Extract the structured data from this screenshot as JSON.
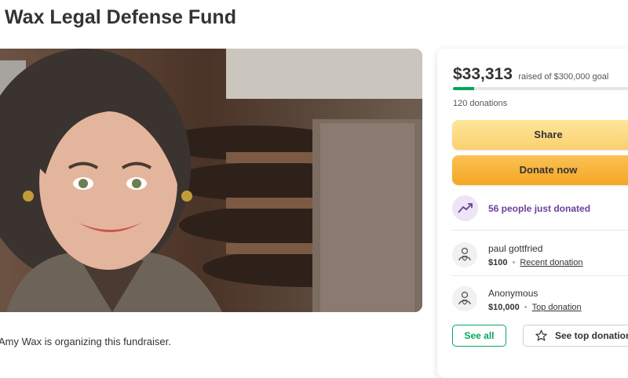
{
  "page": {
    "title": "Wax Legal Defense Fund",
    "organizer_text": "Amy Wax is organizing this fundraiser."
  },
  "hero": {
    "image_alt": "Photo of Amy Wax in a lecture hall"
  },
  "card": {
    "amount": "$33,313",
    "goal_text": "raised of $300,000 goal",
    "progress_fraction": 0.111,
    "donations_count": "120 donations",
    "share_label": "Share",
    "donate_label": "Donate now",
    "trend_text": "56 people just donated",
    "donors": [
      {
        "name": "paul gottfried",
        "amount": "$100",
        "tag": "Recent donation"
      },
      {
        "name": "Anonymous",
        "amount": "$10,000",
        "tag": "Top donation"
      }
    ],
    "see_all_label": "See all",
    "see_top_label": "See top donations"
  },
  "colors": {
    "brand_green": "#02a95c",
    "share_yellow": "#fbd06f",
    "donate_orange": "#f5a624",
    "trend_purple": "#6b3fa0"
  },
  "icons": [
    "trending-up-icon",
    "donor-heart-icon",
    "star-outline-icon"
  ]
}
